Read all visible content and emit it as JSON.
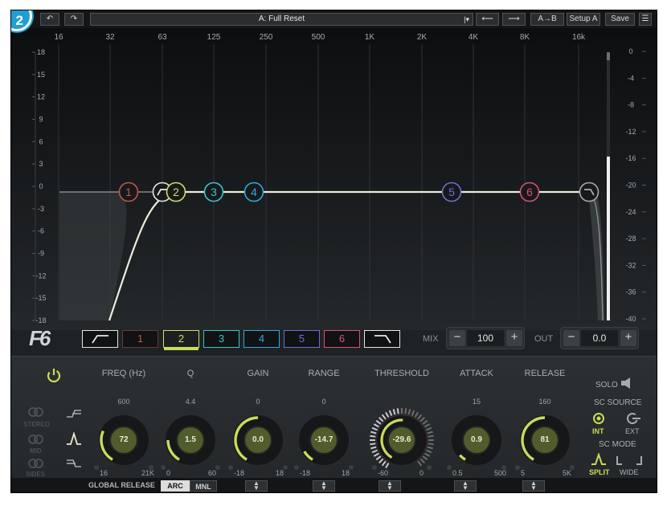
{
  "badge": "2",
  "toolbar": {
    "undo": "↶",
    "redo": "↷",
    "preset": "A: Full Reset",
    "preset_arrow": "|▾",
    "prev": "⟵",
    "next": "⟶",
    "ab": "A→B",
    "setup": "Setup A",
    "save": "Save",
    "menu": "☰"
  },
  "freq_labels": [
    "16",
    "32",
    "63",
    "125",
    "250",
    "500",
    "1K",
    "2K",
    "4K",
    "8K",
    "16k"
  ],
  "gain_labels": [
    "18",
    "15",
    "12",
    "9",
    "6",
    "3",
    "0",
    "-3",
    "-6",
    "-9",
    "-12",
    "-15",
    "-18"
  ],
  "meter_labels": [
    "0",
    "-4",
    "-8",
    "-12",
    "-16",
    "-20",
    "-24",
    "-28",
    "-32",
    "-36",
    "-40"
  ],
  "band_nodes": [
    {
      "label": "1",
      "color": "#c1584b"
    },
    {
      "label": "",
      "color": "#e6e6e6"
    },
    {
      "label": "2",
      "color": "#d2dd6a"
    },
    {
      "label": "3",
      "color": "#3fc3c7"
    },
    {
      "label": "4",
      "color": "#34a8e0"
    },
    {
      "label": "5",
      "color": "#6870d4"
    },
    {
      "label": "6",
      "color": "#d94f7a"
    },
    {
      "label": "",
      "color": "#a7abae"
    }
  ],
  "bands": [
    {
      "label": "",
      "color": "#e6e6e6",
      "icon": "highpass-icon"
    },
    {
      "label": "1",
      "color": "#c1584b"
    },
    {
      "label": "2",
      "color": "#d2dd6a"
    },
    {
      "label": "3",
      "color": "#3fc3c7"
    },
    {
      "label": "4",
      "color": "#34a8e0"
    },
    {
      "label": "5",
      "color": "#6870d4"
    },
    {
      "label": "6",
      "color": "#d94f7a"
    },
    {
      "label": "",
      "color": "#e6e6e6",
      "icon": "lowpass-icon"
    }
  ],
  "logo": "F6",
  "mix": {
    "label": "MIX",
    "value": "100",
    "minus": "−",
    "plus": "+"
  },
  "out": {
    "label": "OUT",
    "value": "0.0",
    "minus": "−",
    "plus": "+"
  },
  "params": [
    {
      "title": "FREQ (Hz)",
      "top": "600",
      "min": "16",
      "max": "21K",
      "value": "72"
    },
    {
      "title": "Q",
      "top": "4.4",
      "min": "0",
      "max": "60",
      "value": "1.5"
    },
    {
      "title": "GAIN",
      "top": "0",
      "min": "-18",
      "max": "18",
      "value": "0.0"
    },
    {
      "title": "RANGE",
      "top": "0",
      "min": "-18",
      "max": "18",
      "value": "-14.7"
    },
    {
      "title": "THRESHOLD",
      "top": "",
      "min": "-60",
      "max": "0",
      "value": "-29.6"
    },
    {
      "title": "ATTACK",
      "top": "15",
      "min": "0.5",
      "max": "500",
      "value": "0.9"
    },
    {
      "title": "RELEASE",
      "top": "160",
      "min": "5",
      "max": "5K",
      "value": "81"
    }
  ],
  "stereo": {
    "stereo": "STEREO",
    "mid": "MID",
    "sides": "SIDES"
  },
  "sc": {
    "solo": "SOLO",
    "source_title": "SC SOURCE",
    "int": "INT",
    "ext": "EXT",
    "mode_title": "SC MODE",
    "split": "SPLIT",
    "wide": "WIDE"
  },
  "footer": {
    "global_release": "GLOBAL RELEASE",
    "arc": "ARC",
    "mnl": "MNL",
    "arrows": "▲\n▼"
  },
  "colors": {
    "accent": "#c8dc5a",
    "threshold_ring": "#d02a2a"
  }
}
